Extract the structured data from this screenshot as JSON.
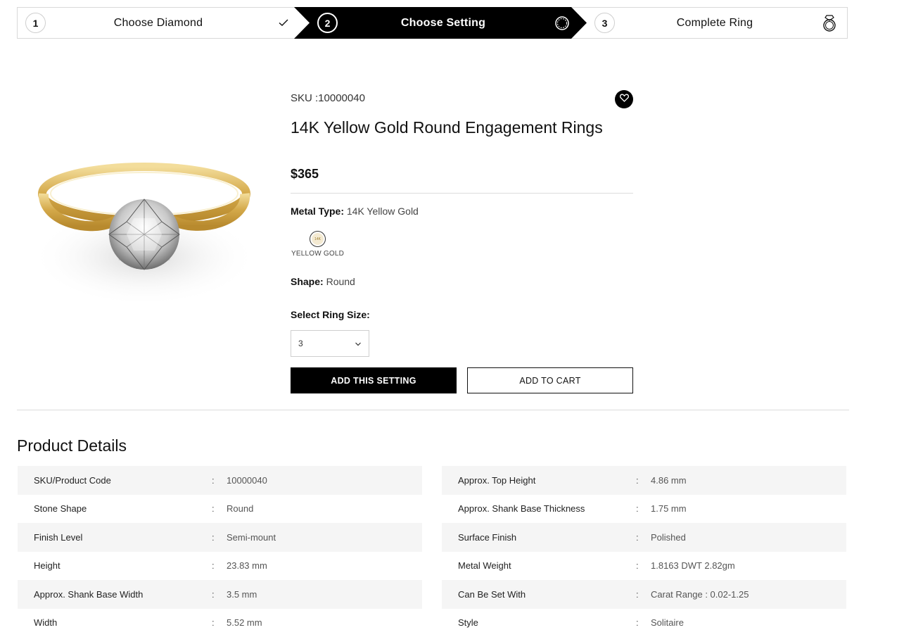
{
  "stepper": {
    "steps": [
      {
        "num": "1",
        "label": "Choose Diamond",
        "icon": "check-icon"
      },
      {
        "num": "2",
        "label": "Choose Setting",
        "icon": "ring-setting-icon"
      },
      {
        "num": "3",
        "label": "Complete Ring",
        "icon": "diamond-ring-icon"
      }
    ],
    "active_step": 2
  },
  "product": {
    "sku": "SKU :10000040",
    "title": "14K Yellow Gold Round Engagement Rings",
    "price": "$365",
    "metal_type_label": "Metal Type:",
    "metal_type_value": "14K Yellow Gold",
    "swatch_text": "14K",
    "swatch_label": "YELLOW GOLD",
    "shape_label": "Shape:",
    "shape_value": "Round",
    "ring_size_label": "Select Ring Size:",
    "ring_size_value": "3",
    "add_setting_label": "ADD THIS SETTING",
    "add_cart_label": "ADD TO CART"
  },
  "details": {
    "title": "Product Details",
    "left": [
      {
        "k": "SKU/Product Code",
        "v": "10000040"
      },
      {
        "k": "Stone Shape",
        "v": "Round"
      },
      {
        "k": "Finish Level",
        "v": "Semi-mount"
      },
      {
        "k": "Height",
        "v": "23.83 mm"
      },
      {
        "k": "Approx. Shank Base Width",
        "v": "3.5 mm"
      },
      {
        "k": "Width",
        "v": "5.52 mm"
      }
    ],
    "right": [
      {
        "k": "Approx. Top Height",
        "v": "4.86 mm"
      },
      {
        "k": "Approx. Shank Base Thickness",
        "v": "1.75 mm"
      },
      {
        "k": "Surface Finish",
        "v": "Polished"
      },
      {
        "k": "Metal Weight",
        "v": "1.8163 DWT 2.82gm"
      },
      {
        "k": "Can Be Set With",
        "v": "Carat Range : 0.02-1.25"
      },
      {
        "k": "Style",
        "v": "Solitaire"
      }
    ],
    "separator": ":"
  },
  "colors": {
    "accent": "#000000",
    "row_stripe": "#f5f5f5",
    "gold": "#d9b45a"
  }
}
